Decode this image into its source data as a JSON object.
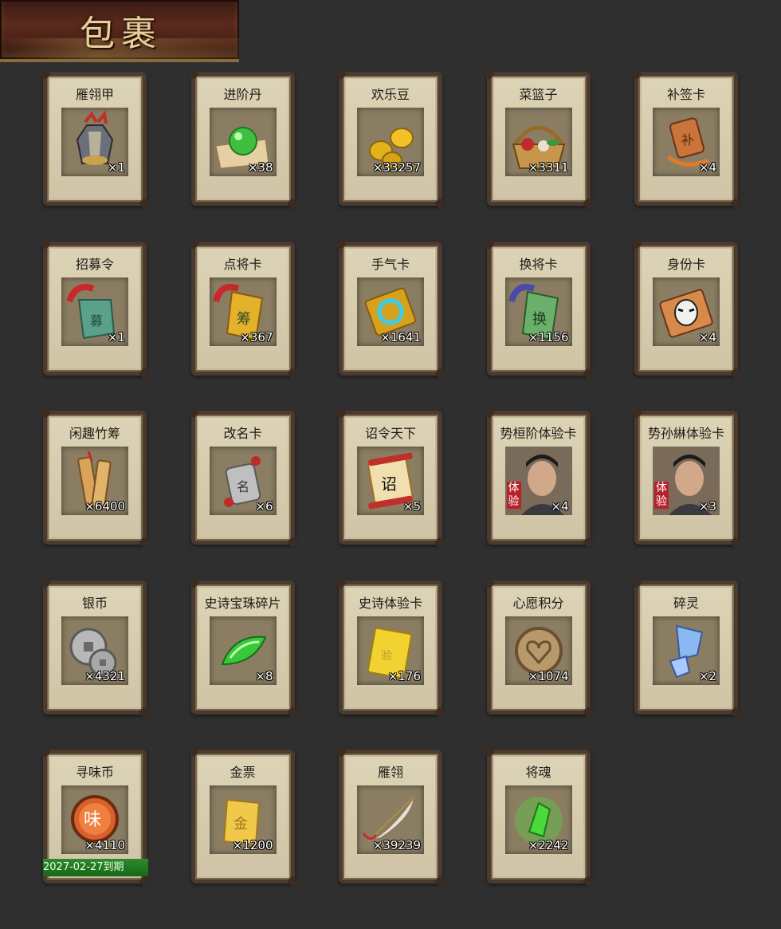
{
  "window": {
    "title": "包裹"
  },
  "items": [
    {
      "name": "雁翎甲",
      "count": "×1",
      "icon": "armor-icon"
    },
    {
      "name": "进阶丹",
      "count": "×38",
      "icon": "jade-pill-icon"
    },
    {
      "name": "欢乐豆",
      "count": "×33257",
      "icon": "gold-beans-icon"
    },
    {
      "name": "菜篮子",
      "count": "×3311",
      "icon": "basket-icon"
    },
    {
      "name": "补签卡",
      "count": "×4",
      "icon": "resign-card-icon"
    },
    {
      "name": "招募令",
      "count": "×1",
      "icon": "recruit-token-icon"
    },
    {
      "name": "点将卡",
      "count": "×367",
      "icon": "general-select-card-icon"
    },
    {
      "name": "手气卡",
      "count": "×1641",
      "icon": "luck-card-icon"
    },
    {
      "name": "换将卡",
      "count": "×1156",
      "icon": "swap-general-card-icon"
    },
    {
      "name": "身份卡",
      "count": "×4",
      "icon": "identity-mask-icon"
    },
    {
      "name": "闲趣竹筹",
      "count": "×6400",
      "icon": "bamboo-tally-icon"
    },
    {
      "name": "改名卡",
      "count": "×6",
      "icon": "rename-card-icon"
    },
    {
      "name": "诏令天下",
      "count": "×5",
      "icon": "edict-scroll-icon"
    },
    {
      "name": "势桓阶体验卡",
      "count": "×4",
      "icon": "general-portrait-icon",
      "badge": "体验"
    },
    {
      "name": "势孙綝体验卡",
      "count": "×3",
      "icon": "general-portrait-icon",
      "badge": "体验"
    },
    {
      "name": "银币",
      "count": "×4321",
      "icon": "silver-coin-icon"
    },
    {
      "name": "史诗宝珠碎片",
      "count": "×8",
      "icon": "green-shard-icon"
    },
    {
      "name": "史诗体验卡",
      "count": "×176",
      "icon": "gold-card-icon"
    },
    {
      "name": "心愿积分",
      "count": "×1074",
      "icon": "heart-coin-icon"
    },
    {
      "name": "碎灵",
      "count": "×2",
      "icon": "blue-crystal-icon"
    },
    {
      "name": "寻味币",
      "count": "×4110",
      "icon": "taste-coin-icon",
      "expiry": "2027-02-27到期"
    },
    {
      "name": "金票",
      "count": "×1200",
      "icon": "gold-ticket-icon"
    },
    {
      "name": "雁翎",
      "count": "×39239",
      "icon": "feather-icon"
    },
    {
      "name": "将魂",
      "count": "×2242",
      "icon": "green-soul-icon"
    }
  ],
  "colors": {
    "background": "#2f2f2f",
    "card": "#d7cdb0",
    "card_border": "#4b3a2e",
    "expiry_bar": "#2d8a2d"
  }
}
